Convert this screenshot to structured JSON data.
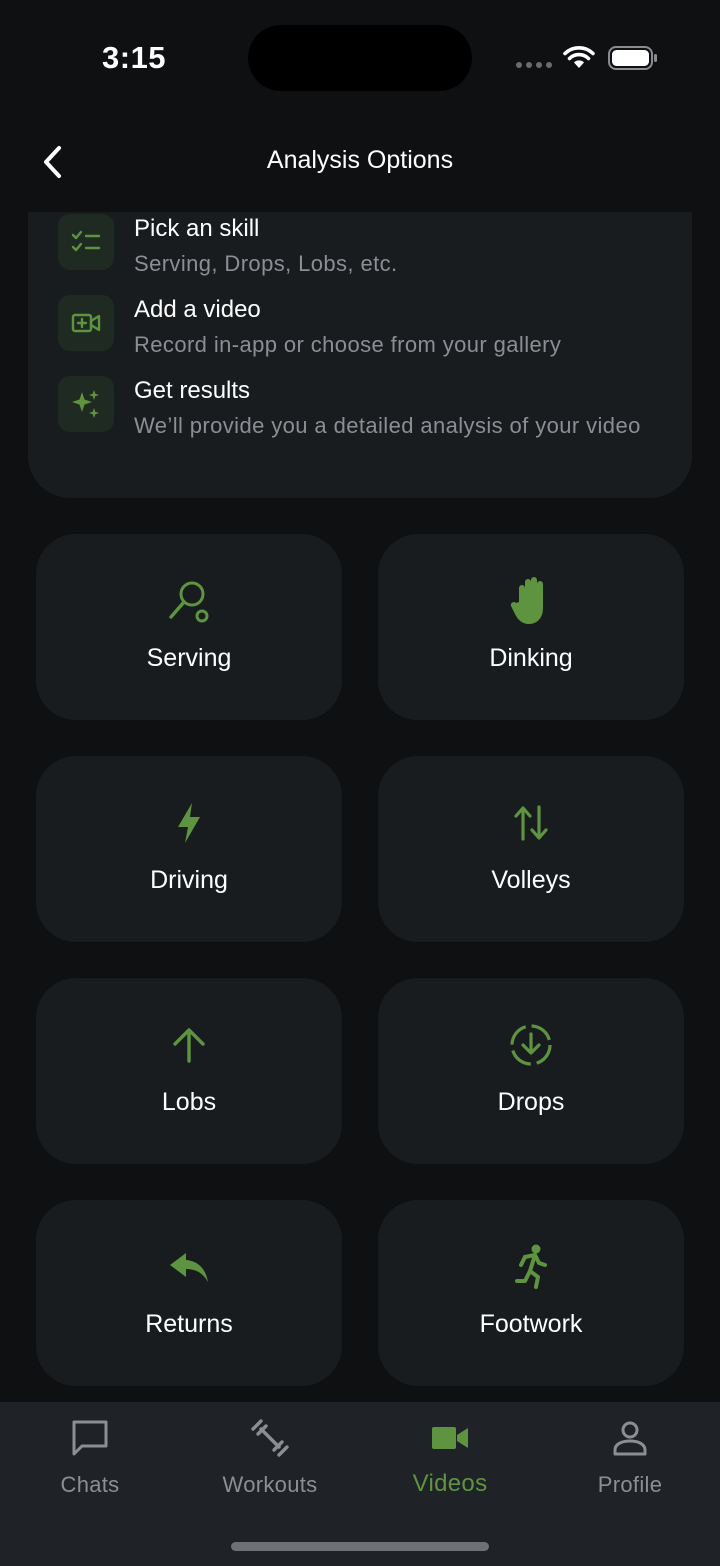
{
  "status": {
    "time": "3:15"
  },
  "header": {
    "title": "Analysis Options"
  },
  "steps": [
    {
      "title": "Pick an skill",
      "subtitle": "Serving, Drops, Lobs, etc.",
      "icon": "checklist-icon"
    },
    {
      "title": "Add a video",
      "subtitle": "Record in-app or choose from your gallery",
      "icon": "video-add-icon"
    },
    {
      "title": "Get results",
      "subtitle": "We’ll provide you a detailed analysis of your video",
      "icon": "sparkles-icon"
    }
  ],
  "skills": [
    {
      "label": "Serving",
      "icon": "racket-icon"
    },
    {
      "label": "Dinking",
      "icon": "hand-icon"
    },
    {
      "label": "Driving",
      "icon": "bolt-icon"
    },
    {
      "label": "Volleys",
      "icon": "swap-vertical-icon"
    },
    {
      "label": "Lobs",
      "icon": "arrow-up-icon"
    },
    {
      "label": "Drops",
      "icon": "download-circle-icon"
    },
    {
      "label": "Returns",
      "icon": "reply-icon"
    },
    {
      "label": "Footwork",
      "icon": "runner-icon"
    }
  ],
  "tabs": [
    {
      "label": "Chats",
      "icon": "chat-icon",
      "active": false
    },
    {
      "label": "Workouts",
      "icon": "dumbbell-icon",
      "active": false
    },
    {
      "label": "Videos",
      "icon": "video-camera-icon",
      "active": true
    },
    {
      "label": "Profile",
      "icon": "person-icon",
      "active": false
    }
  ],
  "colors": {
    "accent": "#5e9440",
    "background": "#0e1012",
    "card": "#181c1f",
    "muted_text": "#8b8f93"
  }
}
